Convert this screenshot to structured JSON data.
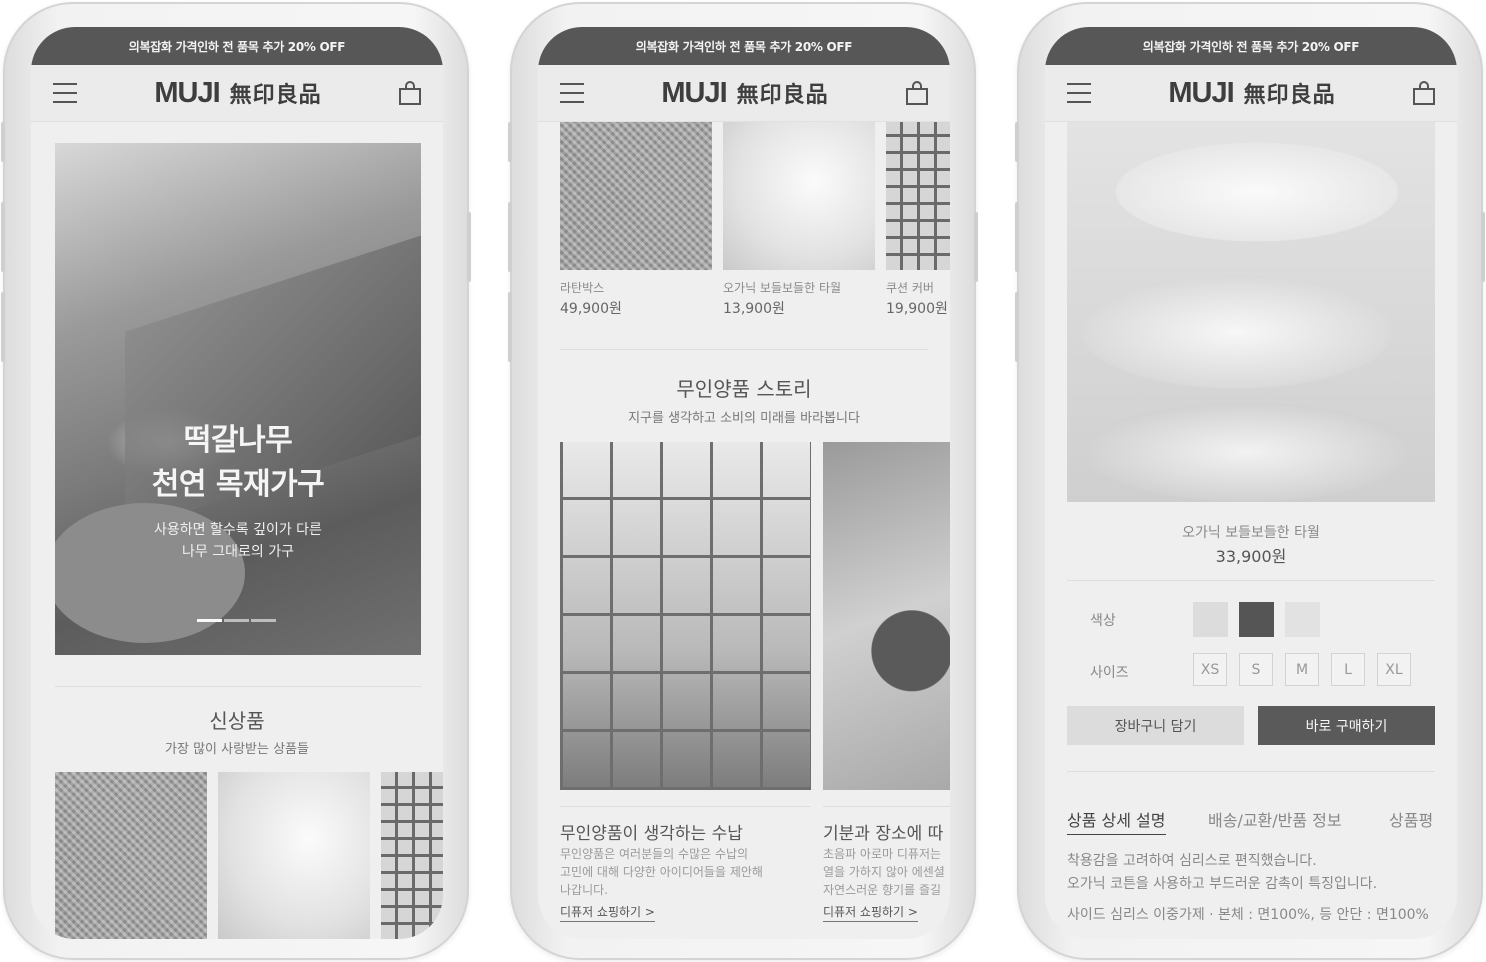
{
  "common": {
    "promo_banner": "의복잡화 가격인하 전 품목 추가 20% OFF",
    "logo_en": "MUJI",
    "logo_kr": "無印良品"
  },
  "phone1": {
    "hero": {
      "title_line1": "떡갈나무",
      "title_line2": "천연 목재가구",
      "sub_line1": "사용하면 할수록 깊이가 다른",
      "sub_line2": "나무 그대로의 가구"
    },
    "new_section": {
      "title": "신상품",
      "subtitle": "가장 많이 사랑받는 상품들"
    }
  },
  "phone2": {
    "products": [
      {
        "name": "라탄박스",
        "price": "49,900원"
      },
      {
        "name": "오가닉 보들보들한 타월",
        "price": "13,900원"
      },
      {
        "name": "쿠션 커버",
        "price": "19,900원"
      }
    ],
    "story": {
      "title": "무인양품 스토리",
      "subtitle": "지구를 생각하고 소비의 미래를 바라봅니다",
      "cards": [
        {
          "title": "무인양품이 생각하는 수납",
          "desc_line1": "무인양품은 여러분들의 수많은 수납의",
          "desc_line2": "고민에 대해 다양한 아이디어들을 제안해",
          "desc_line3": "나갑니다.",
          "link": "디퓨저 쇼핑하기 >"
        },
        {
          "title": "기분과 장소에 따",
          "desc_line1": "초음파 아로마 디퓨저는",
          "desc_line2": "열을 가하지 않아 에센셜",
          "desc_line3": "자연스러운 향기를 즐길",
          "link": "디퓨저 쇼핑하기 >"
        }
      ]
    }
  },
  "phone3": {
    "product_name": "오가닉 보들보들한 타월",
    "price": "33,900원",
    "color_label": "색상",
    "colors": [
      "#dcdcdc",
      "#555555",
      "#e2e2e2"
    ],
    "size_label": "사이즈",
    "sizes": [
      "XS",
      "S",
      "M",
      "L",
      "XL"
    ],
    "cart_button": "장바구니 담기",
    "buy_button": "바로 구매하기",
    "tabs": [
      "상품 상세 설명",
      "배송/교환/반품 정보",
      "상품평"
    ],
    "description": [
      "착용감을 고려하여 심리스로 편직했습니다.",
      "오가닉 코튼을 사용하고 부드러운 감촉이 특징입니다.",
      "사이드 심리스 이중가제 · 본체 : 면100%, 등 안단 : 면100%"
    ]
  }
}
